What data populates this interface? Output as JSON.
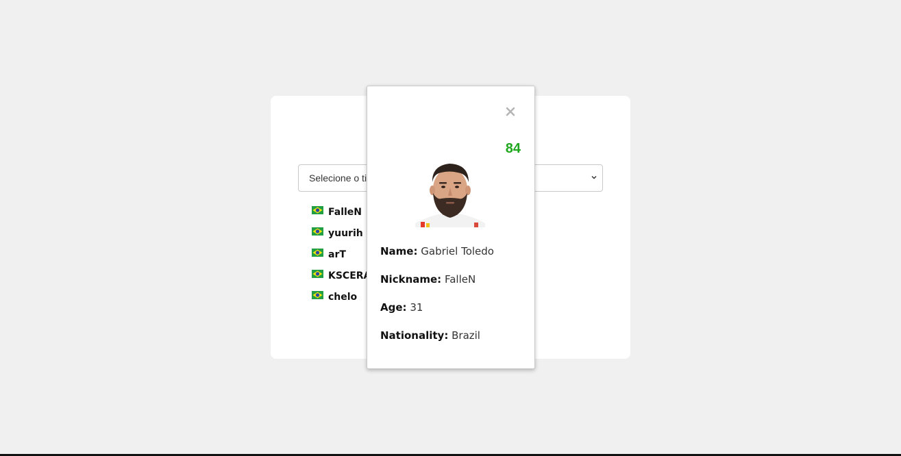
{
  "select": {
    "selected_text": "Selecione o time"
  },
  "players": [
    {
      "name": "FalleN",
      "flag": "brazil"
    },
    {
      "name": "yuurih",
      "flag": "brazil"
    },
    {
      "name": "arT",
      "flag": "brazil"
    },
    {
      "name": "KSCERATO",
      "flag": "brazil"
    },
    {
      "name": "chelo",
      "flag": "brazil"
    }
  ],
  "modal": {
    "rating": "84",
    "name_label": "Name:",
    "name_value": "Gabriel Toledo",
    "nickname_label": "Nickname:",
    "nickname_value": "FalleN",
    "age_label": "Age:",
    "age_value": "31",
    "nationality_label": "Nationality:",
    "nationality_value": "Brazil"
  },
  "colors": {
    "background": "#f0f0f0",
    "rating": "#1fa81f",
    "close": "#b5b5b5"
  }
}
